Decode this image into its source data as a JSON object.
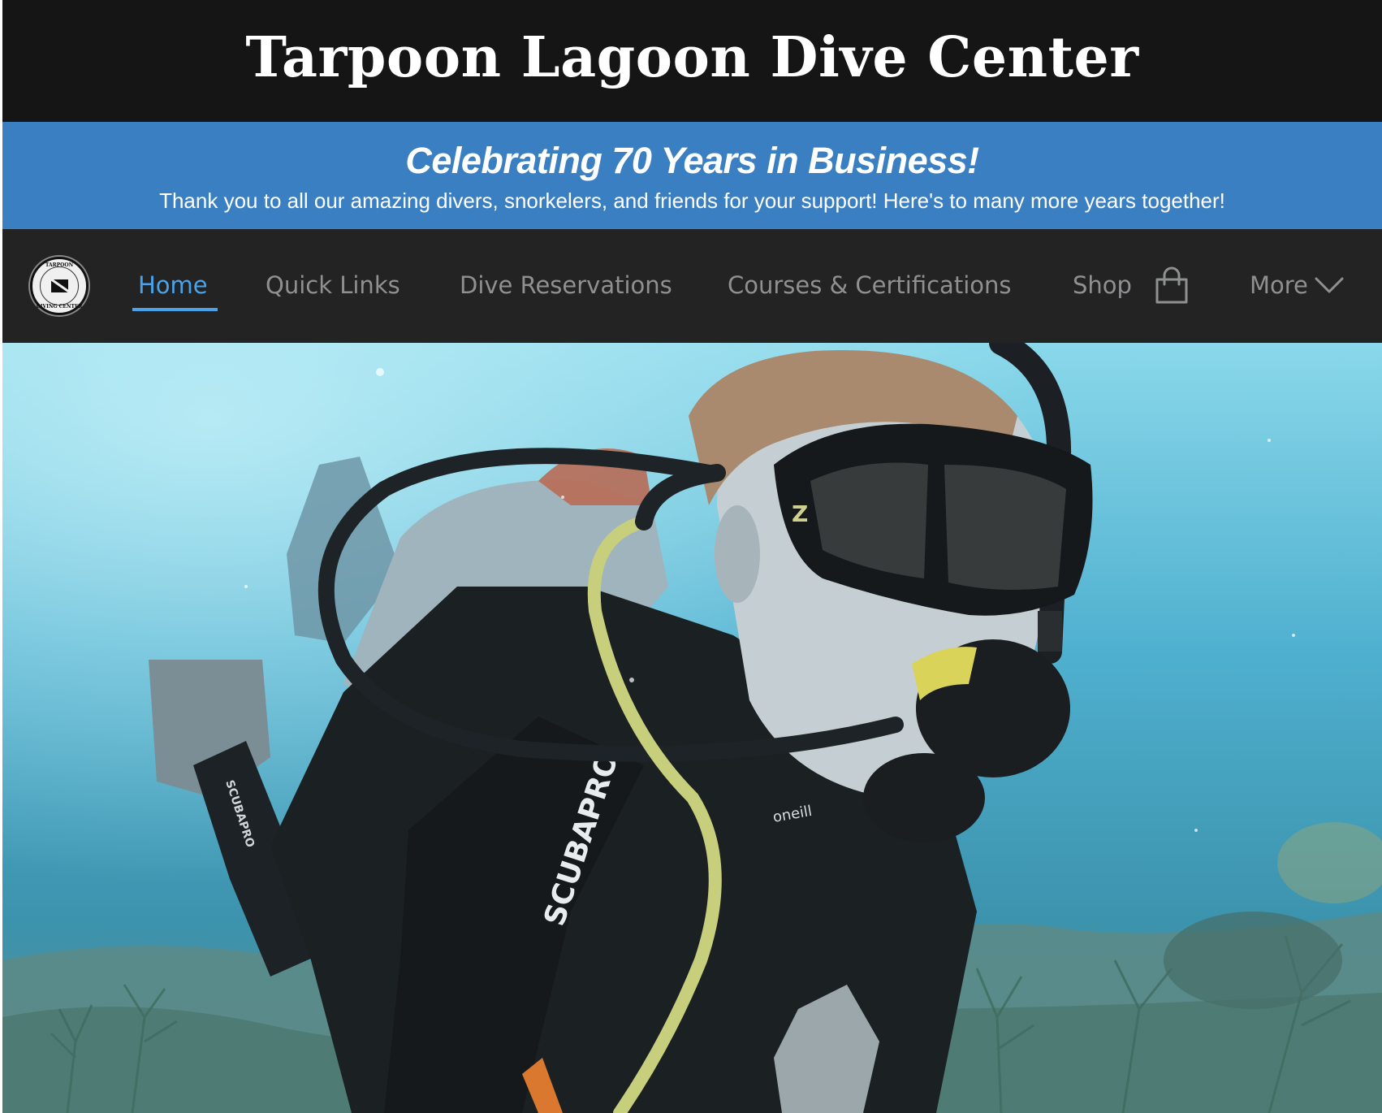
{
  "header": {
    "title": "Tarpoon Lagoon Dive Center"
  },
  "banner": {
    "headline": "Celebrating 70 Years in Business!",
    "message": "Thank you to all our amazing divers, snorkelers, and friends for your support! Here's to many more years together!",
    "color": "#3a7fc2"
  },
  "nav": {
    "logo_icon": "tarpoon-diving-center-logo",
    "logo_text_top": "TARPOON",
    "logo_text_bottom": "DIVING CENTER",
    "items": [
      {
        "label": "Home",
        "active": true
      },
      {
        "label": "Quick Links",
        "active": false
      },
      {
        "label": "Dive Reservations",
        "active": false
      },
      {
        "label": "Courses & Certifications",
        "active": false
      },
      {
        "label": "Shop",
        "active": false
      },
      {
        "label": "More",
        "active": false
      }
    ],
    "shop_icon": "shopping-bag-icon",
    "more_icon": "chevron-down-icon",
    "active_color": "#4aa3e8",
    "inactive_color": "#8f9092"
  },
  "hero": {
    "image": "scuba-diver-underwater-photo",
    "fin_text": "SCUBAPRO",
    "sleeve_text": "SCUBAPRO",
    "chest_text": "oneill",
    "mask_mark": "Z"
  }
}
